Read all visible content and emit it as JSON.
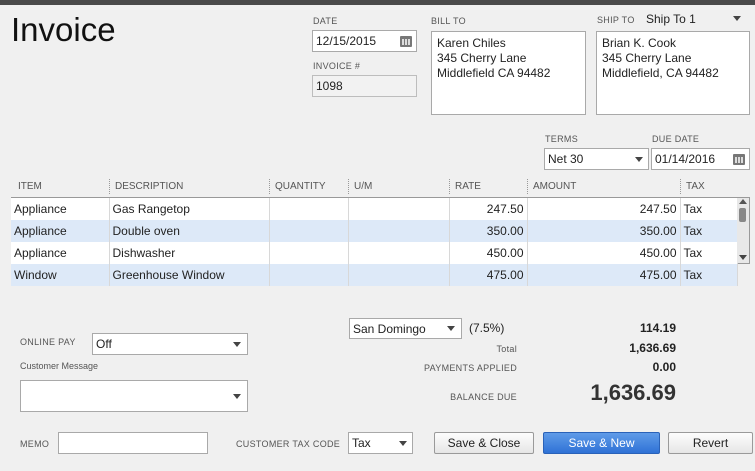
{
  "form": {
    "title": "Invoice"
  },
  "date": {
    "label": "DATE",
    "value": "12/15/2015"
  },
  "invoice_no": {
    "label": "INVOICE #",
    "value": "1098"
  },
  "bill_to": {
    "label": "BILL TO",
    "lines": [
      "Karen Chiles",
      "345 Cherry Lane",
      "Middlefield CA 94482"
    ]
  },
  "ship_to": {
    "label": "SHIP TO",
    "selected": "Ship To 1",
    "lines": [
      "Brian K. Cook",
      "345 Cherry Lane",
      "Middlefield, CA 94482"
    ]
  },
  "terms": {
    "label": "TERMS",
    "value": "Net 30"
  },
  "due_date": {
    "label": "DUE DATE",
    "value": "01/14/2016"
  },
  "table": {
    "headers": {
      "item": "ITEM",
      "description": "DESCRIPTION",
      "quantity": "QUANTITY",
      "um": "U/M",
      "rate": "RATE",
      "amount": "AMOUNT",
      "tax": "TAX"
    },
    "rows": [
      {
        "item": "Appliance",
        "description": "Gas Rangetop",
        "quantity": "",
        "um": "",
        "rate": "247.50",
        "amount": "247.50",
        "tax": "Tax"
      },
      {
        "item": "Appliance",
        "description": "Double oven",
        "quantity": "",
        "um": "",
        "rate": "350.00",
        "amount": "350.00",
        "tax": "Tax"
      },
      {
        "item": "Appliance",
        "description": "Dishwasher",
        "quantity": "",
        "um": "",
        "rate": "450.00",
        "amount": "450.00",
        "tax": "Tax"
      },
      {
        "item": "Window",
        "description": "Greenhouse Window",
        "quantity": "",
        "um": "",
        "rate": "475.00",
        "amount": "475.00",
        "tax": "Tax"
      }
    ]
  },
  "online_pay": {
    "label": "ONLINE PAY",
    "value": "Off"
  },
  "customer_message": {
    "label": "Customer Message",
    "value": ""
  },
  "memo": {
    "label": "MEMO",
    "value": ""
  },
  "customer_tax_code": {
    "label": "CUSTOMER TAX CODE",
    "value": "Tax"
  },
  "sales_tax": {
    "district": "San Domingo",
    "rate": "(7.5%)",
    "amount": "114.19"
  },
  "totals": {
    "total_label": "Total",
    "total": "1,636.69",
    "payments_label": "PAYMENTS APPLIED",
    "payments": "0.00",
    "balance_label": "BALANCE DUE",
    "balance": "1,636.69"
  },
  "buttons": {
    "save_close": "Save & Close",
    "save_new": "Save & New",
    "revert": "Revert"
  }
}
